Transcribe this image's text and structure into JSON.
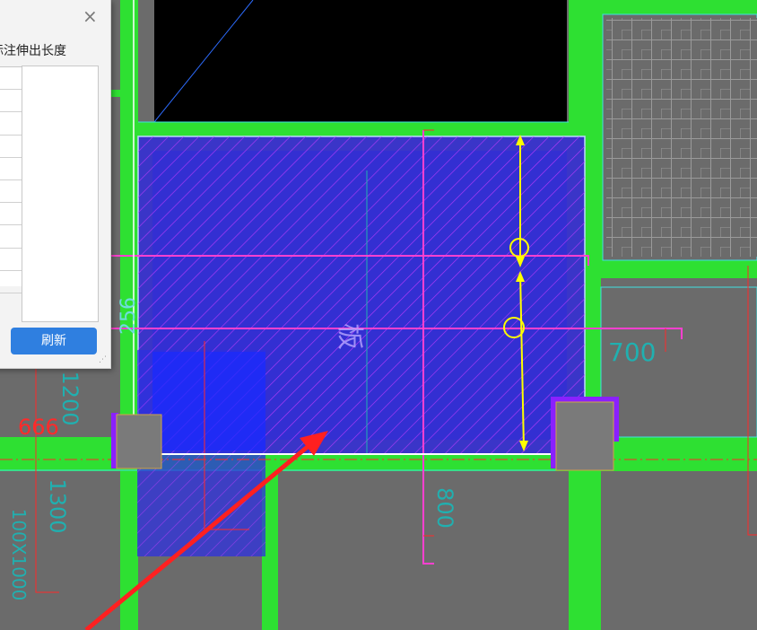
{
  "dialog": {
    "title": "标注伸出长度",
    "close_glyph": "×",
    "refresh_label": "刷新",
    "table_rows": 10
  },
  "drawing": {
    "labels": {
      "vertical_dim_1": "256",
      "vertical_dim_2": "1200",
      "red_dim": "666",
      "dim_700": "700",
      "dim_800": "800",
      "dim_1300": "1300",
      "dim_100x": "100X1000",
      "center_text": "板"
    },
    "colors": {
      "background": "#6b6b6b",
      "wall_green": "#2ee032",
      "slab_blue": "#3a35c8",
      "hatch_magenta": "#c53bff",
      "rebar_magenta": "#ff40d0",
      "dimension_yellow": "#ffff00",
      "annotation_red": "#ff2a2a",
      "dim_cyan": "#20b0b0"
    }
  }
}
